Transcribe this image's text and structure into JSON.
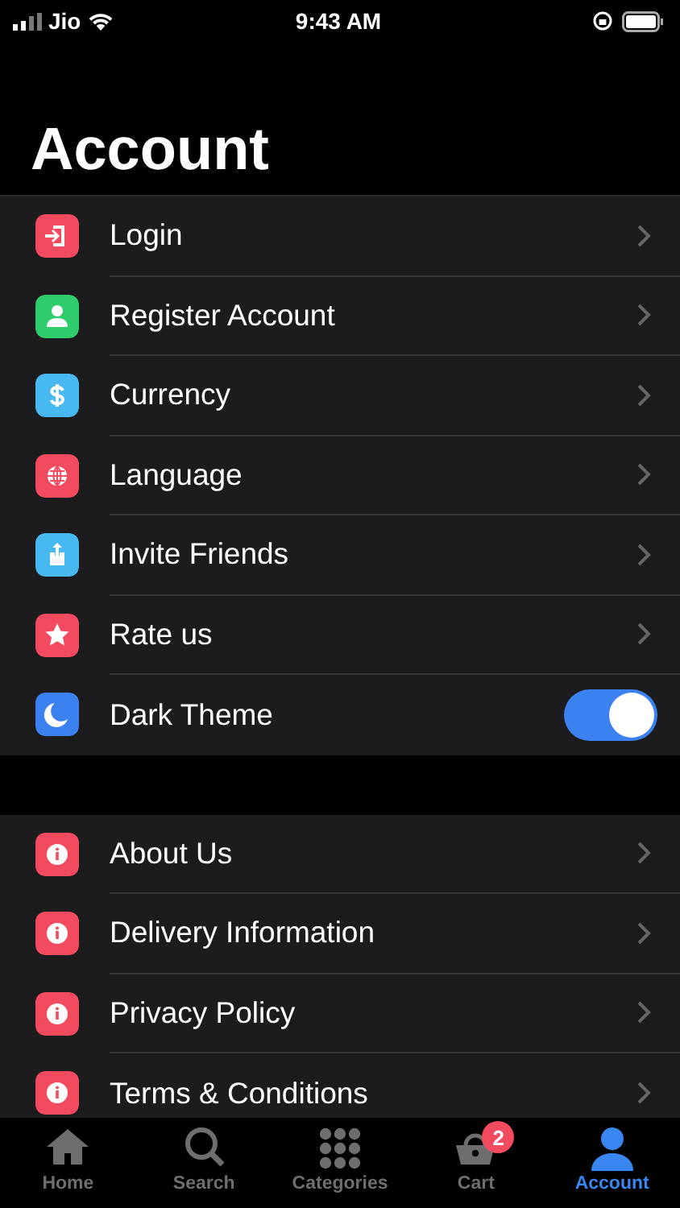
{
  "status_bar": {
    "carrier": "Jio",
    "time": "9:43 AM"
  },
  "title": "Account",
  "groups": [
    {
      "items": [
        {
          "kind": "link",
          "label": "Login",
          "color": "#f24a5e"
        },
        {
          "kind": "link",
          "label": "Register Account",
          "color": "#2ecc6a"
        },
        {
          "kind": "link",
          "label": "Currency",
          "color": "#47b8f0"
        },
        {
          "kind": "link",
          "label": "Language",
          "color": "#f24a5e"
        },
        {
          "kind": "link",
          "label": "Invite Friends",
          "color": "#47b8f0"
        },
        {
          "kind": "link",
          "label": "Rate us",
          "color": "#f24a5e"
        },
        {
          "kind": "toggle",
          "label": "Dark Theme",
          "color": "#3b82f0",
          "on": true
        }
      ]
    },
    {
      "items": [
        {
          "kind": "link",
          "label": "About Us",
          "color": "#f24a5e"
        },
        {
          "kind": "link",
          "label": "Delivery Information",
          "color": "#f24a5e"
        },
        {
          "kind": "link",
          "label": "Privacy Policy",
          "color": "#f24a5e"
        },
        {
          "kind": "link",
          "label": "Terms & Conditions",
          "color": "#f24a5e"
        }
      ]
    }
  ],
  "tabs": [
    {
      "label": "Home",
      "selected": false
    },
    {
      "label": "Search",
      "selected": false
    },
    {
      "label": "Categories",
      "selected": false
    },
    {
      "label": "Cart",
      "selected": false,
      "badge": "2"
    },
    {
      "label": "Account",
      "selected": true
    }
  ]
}
